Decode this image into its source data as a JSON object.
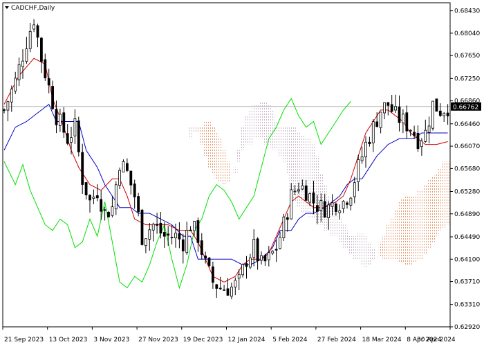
{
  "symbol": "CADCHF,Daily",
  "colors": {
    "background": "#ffffff",
    "frame": "#000000",
    "tenkan": "#d00000",
    "kijun": "#0000c8",
    "chikou": "#00e000",
    "cloud_bull": "#e69b70",
    "cloud_bear": "#c8b8c8",
    "candle": "#000000",
    "price_line": "#b4b4b4",
    "price_badge_bg": "#000000",
    "price_badge_text": "#ffffff"
  },
  "chart_data": {
    "type": "candlestick",
    "indicator": "Ichimoku Kinko Hyo",
    "ylim": [
      0.6292,
      0.6857
    ],
    "y_ticks": [
      0.6843,
      0.6804,
      0.6765,
      0.6725,
      0.6686,
      0.6646,
      0.6607,
      0.6568,
      0.6528,
      0.6489,
      0.6449,
      0.641,
      0.6371,
      0.6331,
      0.6292
    ],
    "y_tick_labels": [
      "0.68430",
      "0.68040",
      "0.67650",
      "0.67250",
      "0.66860",
      "0.66460",
      "0.66070",
      "0.65680",
      "0.65280",
      "0.64890",
      "0.64490",
      "0.64100",
      "0.63710",
      "0.63310",
      "0.62920"
    ],
    "x_labels": [
      "21 Sep 2023",
      "13 Oct 2023",
      "3 Nov 2023",
      "27 Nov 2023",
      "19 Dec 2023",
      "12 Jan 2024",
      "5 Feb 2024",
      "27 Feb 2024",
      "18 Mar 2024",
      "8 Apr 2024",
      "30 Apr 2024"
    ],
    "current_price": 0.66762,
    "current_price_label": "0.66762",
    "price_path": [
      [
        0,
        0.667
      ],
      [
        3,
        0.672
      ],
      [
        6,
        0.679
      ],
      [
        8,
        0.683
      ],
      [
        10,
        0.676
      ],
      [
        12,
        0.671
      ],
      [
        14,
        0.666
      ],
      [
        17,
        0.662
      ],
      [
        19,
        0.664
      ],
      [
        21,
        0.655
      ],
      [
        23,
        0.651
      ],
      [
        25,
        0.653
      ],
      [
        27,
        0.649
      ],
      [
        29,
        0.65
      ],
      [
        31,
        0.658
      ],
      [
        33,
        0.656
      ],
      [
        35,
        0.652
      ],
      [
        37,
        0.645
      ],
      [
        40,
        0.647
      ],
      [
        43,
        0.645
      ],
      [
        46,
        0.645
      ],
      [
        48,
        0.644
      ],
      [
        50,
        0.647
      ],
      [
        52,
        0.645
      ],
      [
        54,
        0.64
      ],
      [
        56,
        0.637
      ],
      [
        58,
        0.636
      ],
      [
        61,
        0.636
      ],
      [
        63,
        0.637
      ],
      [
        65,
        0.641
      ],
      [
        67,
        0.643
      ],
      [
        69,
        0.64
      ],
      [
        71,
        0.641
      ],
      [
        73,
        0.643
      ],
      [
        75,
        0.647
      ],
      [
        77,
        0.652
      ],
      [
        79,
        0.654
      ],
      [
        81,
        0.653
      ],
      [
        83,
        0.651
      ],
      [
        85,
        0.65
      ],
      [
        87,
        0.65
      ],
      [
        89,
        0.651
      ],
      [
        91,
        0.651
      ],
      [
        93,
        0.653
      ],
      [
        95,
        0.657
      ],
      [
        97,
        0.661
      ],
      [
        99,
        0.664
      ],
      [
        101,
        0.667
      ],
      [
        103,
        0.668
      ],
      [
        105,
        0.666
      ],
      [
        107,
        0.665
      ],
      [
        109,
        0.664
      ],
      [
        111,
        0.662
      ],
      [
        113,
        0.663
      ],
      [
        115,
        0.668
      ],
      [
        117,
        0.667
      ],
      [
        119,
        0.6676
      ]
    ],
    "tenkan": [
      [
        0,
        0.668
      ],
      [
        4,
        0.673
      ],
      [
        8,
        0.676
      ],
      [
        11,
        0.675
      ],
      [
        13,
        0.669
      ],
      [
        16,
        0.664
      ],
      [
        18,
        0.66
      ],
      [
        20,
        0.657
      ],
      [
        23,
        0.654
      ],
      [
        26,
        0.653
      ],
      [
        29,
        0.655
      ],
      [
        31,
        0.655
      ],
      [
        33,
        0.652
      ],
      [
        35,
        0.648
      ],
      [
        38,
        0.647
      ],
      [
        41,
        0.647
      ],
      [
        44,
        0.647
      ],
      [
        47,
        0.646
      ],
      [
        50,
        0.646
      ],
      [
        52,
        0.644
      ],
      [
        54,
        0.641
      ],
      [
        56,
        0.638
      ],
      [
        59,
        0.637
      ],
      [
        62,
        0.638
      ],
      [
        64,
        0.64
      ],
      [
        66,
        0.641
      ],
      [
        69,
        0.641
      ],
      [
        71,
        0.642
      ],
      [
        73,
        0.645
      ],
      [
        75,
        0.648
      ],
      [
        77,
        0.651
      ],
      [
        79,
        0.652
      ],
      [
        81,
        0.651
      ],
      [
        83,
        0.65
      ],
      [
        86,
        0.65
      ],
      [
        89,
        0.651
      ],
      [
        91,
        0.652
      ],
      [
        93,
        0.655
      ],
      [
        95,
        0.659
      ],
      [
        97,
        0.663
      ],
      [
        99,
        0.665
      ],
      [
        101,
        0.667
      ],
      [
        103,
        0.667
      ],
      [
        105,
        0.666
      ],
      [
        107,
        0.665
      ],
      [
        109,
        0.663
      ],
      [
        111,
        0.662
      ],
      [
        113,
        0.661
      ],
      [
        116,
        0.661
      ],
      [
        119,
        0.6615
      ]
    ],
    "kijun": [
      [
        0,
        0.66
      ],
      [
        3,
        0.664
      ],
      [
        6,
        0.665
      ],
      [
        9,
        0.6665
      ],
      [
        12,
        0.668
      ],
      [
        14,
        0.665
      ],
      [
        17,
        0.665
      ],
      [
        20,
        0.665
      ],
      [
        22,
        0.66
      ],
      [
        25,
        0.657
      ],
      [
        27,
        0.654
      ],
      [
        29,
        0.652
      ],
      [
        31,
        0.65
      ],
      [
        34,
        0.65
      ],
      [
        36,
        0.649
      ],
      [
        39,
        0.649
      ],
      [
        42,
        0.648
      ],
      [
        45,
        0.647
      ],
      [
        48,
        0.645
      ],
      [
        50,
        0.645
      ],
      [
        52,
        0.641
      ],
      [
        55,
        0.641
      ],
      [
        57,
        0.641
      ],
      [
        59,
        0.641
      ],
      [
        61,
        0.641
      ],
      [
        64,
        0.64
      ],
      [
        66,
        0.64
      ],
      [
        69,
        0.641
      ],
      [
        72,
        0.643
      ],
      [
        74,
        0.646
      ],
      [
        77,
        0.646
      ],
      [
        79,
        0.648
      ],
      [
        81,
        0.649
      ],
      [
        83,
        0.649
      ],
      [
        86,
        0.65
      ],
      [
        88,
        0.651
      ],
      [
        90,
        0.652
      ],
      [
        92,
        0.654
      ],
      [
        94,
        0.655
      ],
      [
        96,
        0.655
      ],
      [
        98,
        0.657
      ],
      [
        100,
        0.659
      ],
      [
        103,
        0.661
      ],
      [
        106,
        0.662
      ],
      [
        108,
        0.662
      ],
      [
        110,
        0.662
      ],
      [
        112,
        0.663
      ],
      [
        115,
        0.663
      ],
      [
        117,
        0.663
      ],
      [
        119,
        0.663
      ]
    ],
    "chikou": [
      [
        0,
        0.658
      ],
      [
        3,
        0.654
      ],
      [
        5,
        0.6575
      ],
      [
        7,
        0.653
      ],
      [
        9,
        0.65
      ],
      [
        11,
        0.647
      ],
      [
        13,
        0.646
      ],
      [
        15,
        0.648
      ],
      [
        17,
        0.647
      ],
      [
        19,
        0.643
      ],
      [
        21,
        0.644
      ],
      [
        23,
        0.648
      ],
      [
        25,
        0.645
      ],
      [
        27,
        0.651
      ],
      [
        29,
        0.644
      ],
      [
        31,
        0.637
      ],
      [
        33,
        0.636
      ],
      [
        35,
        0.638
      ],
      [
        37,
        0.637
      ],
      [
        39,
        0.64
      ],
      [
        41,
        0.644
      ],
      [
        43,
        0.647
      ],
      [
        45,
        0.641
      ],
      [
        47,
        0.636
      ],
      [
        49,
        0.64
      ],
      [
        51,
        0.646
      ],
      [
        53,
        0.648
      ],
      [
        55,
        0.652
      ],
      [
        57,
        0.654
      ],
      [
        59,
        0.653
      ],
      [
        61,
        0.651
      ],
      [
        63,
        0.648
      ],
      [
        65,
        0.65
      ],
      [
        67,
        0.652
      ],
      [
        69,
        0.657
      ],
      [
        71,
        0.662
      ],
      [
        73,
        0.664
      ],
      [
        75,
        0.667
      ],
      [
        77,
        0.669
      ],
      [
        79,
        0.666
      ],
      [
        81,
        0.664
      ],
      [
        83,
        0.665
      ],
      [
        85,
        0.661
      ],
      [
        87,
        0.663
      ],
      [
        89,
        0.665
      ],
      [
        91,
        0.667
      ],
      [
        93,
        0.6685
      ]
    ],
    "cloud": [
      {
        "a": 0.662,
        "b": 0.664
      },
      {
        "a": 0.663,
        "b": 0.664
      },
      {
        "a": 0.664,
        "b": 0.663
      },
      {
        "a": 0.664,
        "b": 0.661
      },
      {
        "a": 0.665,
        "b": 0.659
      },
      {
        "a": 0.665,
        "b": 0.657
      },
      {
        "a": 0.664,
        "b": 0.656
      },
      {
        "a": 0.663,
        "b": 0.655
      },
      {
        "a": 0.662,
        "b": 0.6545
      },
      {
        "a": 0.66,
        "b": 0.654
      },
      {
        "a": 0.658,
        "b": 0.6545
      },
      {
        "a": 0.655,
        "b": 0.655
      },
      {
        "a": 0.656,
        "b": 0.657
      },
      {
        "a": 0.658,
        "b": 0.66
      },
      {
        "a": 0.66,
        "b": 0.664
      },
      {
        "a": 0.661,
        "b": 0.666
      },
      {
        "a": 0.661,
        "b": 0.667
      },
      {
        "a": 0.662,
        "b": 0.668
      },
      {
        "a": 0.662,
        "b": 0.668
      },
      {
        "a": 0.662,
        "b": 0.6685
      },
      {
        "a": 0.661,
        "b": 0.6685
      },
      {
        "a": 0.661,
        "b": 0.668
      },
      {
        "a": 0.66,
        "b": 0.667
      },
      {
        "a": 0.66,
        "b": 0.665
      },
      {
        "a": 0.659,
        "b": 0.664
      },
      {
        "a": 0.658,
        "b": 0.664
      },
      {
        "a": 0.656,
        "b": 0.664
      },
      {
        "a": 0.653,
        "b": 0.664
      },
      {
        "a": 0.651,
        "b": 0.664
      },
      {
        "a": 0.65,
        "b": 0.663
      },
      {
        "a": 0.649,
        "b": 0.6625
      },
      {
        "a": 0.649,
        "b": 0.662
      },
      {
        "a": 0.648,
        "b": 0.662
      },
      {
        "a": 0.648,
        "b": 0.661
      },
      {
        "a": 0.647,
        "b": 0.659
      },
      {
        "a": 0.647,
        "b": 0.656
      },
      {
        "a": 0.646,
        "b": 0.654
      },
      {
        "a": 0.646,
        "b": 0.652
      },
      {
        "a": 0.645,
        "b": 0.6505
      },
      {
        "a": 0.645,
        "b": 0.6495
      },
      {
        "a": 0.644,
        "b": 0.648
      },
      {
        "a": 0.643,
        "b": 0.647
      },
      {
        "a": 0.643,
        "b": 0.646
      },
      {
        "a": 0.642,
        "b": 0.645
      },
      {
        "a": 0.641,
        "b": 0.645
      },
      {
        "a": 0.641,
        "b": 0.6455
      },
      {
        "a": 0.64,
        "b": 0.6455
      },
      {
        "a": 0.6395,
        "b": 0.645
      },
      {
        "a": 0.64,
        "b": 0.644
      },
      {
        "a": 0.641,
        "b": 0.643
      },
      {
        "a": 0.642,
        "b": 0.642
      },
      {
        "a": 0.644,
        "b": 0.6415
      },
      {
        "a": 0.645,
        "b": 0.641
      },
      {
        "a": 0.647,
        "b": 0.641
      },
      {
        "a": 0.648,
        "b": 0.641
      },
      {
        "a": 0.6495,
        "b": 0.641
      },
      {
        "a": 0.651,
        "b": 0.6405
      },
      {
        "a": 0.6515,
        "b": 0.6405
      },
      {
        "a": 0.652,
        "b": 0.64
      },
      {
        "a": 0.652,
        "b": 0.64
      },
      {
        "a": 0.652,
        "b": 0.6405
      },
      {
        "a": 0.653,
        "b": 0.641
      },
      {
        "a": 0.653,
        "b": 0.641
      },
      {
        "a": 0.654,
        "b": 0.642
      },
      {
        "a": 0.655,
        "b": 0.643
      },
      {
        "a": 0.6555,
        "b": 0.644
      },
      {
        "a": 0.656,
        "b": 0.645
      },
      {
        "a": 0.657,
        "b": 0.646
      },
      {
        "a": 0.658,
        "b": 0.6465
      },
      {
        "a": 0.658,
        "b": 0.647
      }
    ]
  }
}
